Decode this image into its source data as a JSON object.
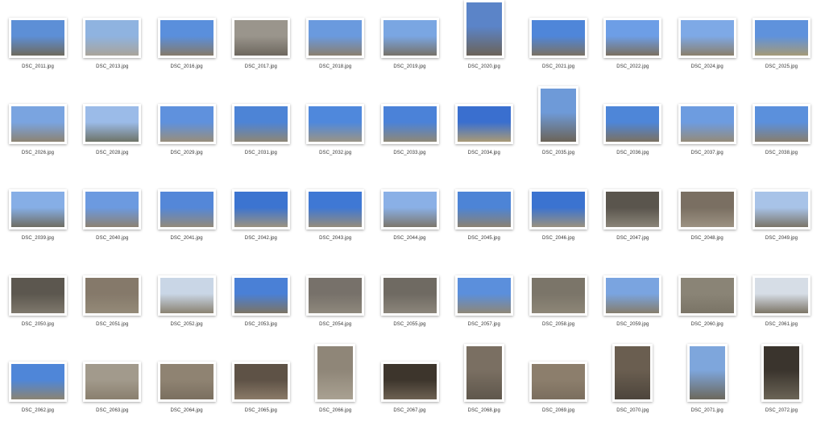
{
  "window": {
    "background": "#ffffff"
  },
  "files": [
    {
      "name": "DSC_2011.jpg",
      "orientation": "landscape",
      "sky": "#5d8fd6",
      "ground": "#6e6a5e"
    },
    {
      "name": "DSC_2013.jpg",
      "orientation": "landscape",
      "sky": "#8fb3e0",
      "ground": "#a9a49a"
    },
    {
      "name": "DSC_2016.jpg",
      "orientation": "landscape",
      "sky": "#5a8fdc",
      "ground": "#857a6a"
    },
    {
      "name": "DSC_2017.jpg",
      "orientation": "landscape",
      "sky": "#9a958c",
      "ground": "#6d675e"
    },
    {
      "name": "DSC_2018.jpg",
      "orientation": "landscape",
      "sky": "#6a9ade",
      "ground": "#8a7f6f"
    },
    {
      "name": "DSC_2019.jpg",
      "orientation": "landscape",
      "sky": "#7aa6e2",
      "ground": "#77726a"
    },
    {
      "name": "DSC_2020.jpg",
      "orientation": "portrait",
      "sky": "#5b84c8",
      "ground": "#6b6358"
    },
    {
      "name": "DSC_2021.jpg",
      "orientation": "landscape",
      "sky": "#4f86d9",
      "ground": "#7b7264"
    },
    {
      "name": "DSC_2022.jpg",
      "orientation": "landscape",
      "sky": "#6d9ee6",
      "ground": "#7a6f60"
    },
    {
      "name": "DSC_2024.jpg",
      "orientation": "landscape",
      "sky": "#7ea9e6",
      "ground": "#8a7f6c"
    },
    {
      "name": "DSC_2025.jpg",
      "orientation": "landscape",
      "sky": "#5f92dc",
      "ground": "#a59a78"
    },
    {
      "name": "DSC_2026.jpg",
      "orientation": "landscape",
      "sky": "#7aa4e0",
      "ground": "#8c8373"
    },
    {
      "name": "DSC_2028.jpg",
      "orientation": "landscape",
      "sky": "#9bbbe8",
      "ground": "#6e7368"
    },
    {
      "name": "DSC_2029.jpg",
      "orientation": "landscape",
      "sky": "#5f91dd",
      "ground": "#988e7c"
    },
    {
      "name": "DSC_2031.jpg",
      "orientation": "landscape",
      "sky": "#4d84d6",
      "ground": "#8d8676"
    },
    {
      "name": "DSC_2032.jpg",
      "orientation": "landscape",
      "sky": "#4f88dc",
      "ground": "#9a9486"
    },
    {
      "name": "DSC_2033.jpg",
      "orientation": "landscape",
      "sky": "#4b82d8",
      "ground": "#8e8878"
    },
    {
      "name": "DSC_2034.jpg",
      "orientation": "landscape",
      "sky": "#3a6fcf",
      "ground": "#a99a76"
    },
    {
      "name": "DSC_2035.jpg",
      "orientation": "portrait",
      "sky": "#6e9ad8",
      "ground": "#6b6458"
    },
    {
      "name": "DSC_2036.jpg",
      "orientation": "landscape",
      "sky": "#4e86d8",
      "ground": "#7b7162"
    },
    {
      "name": "DSC_2037.jpg",
      "orientation": "landscape",
      "sky": "#6d9ce0",
      "ground": "#948b7a"
    },
    {
      "name": "DSC_2038.jpg",
      "orientation": "landscape",
      "sky": "#5b90dc",
      "ground": "#877e6e"
    },
    {
      "name": "DSC_2039.jpg",
      "orientation": "landscape",
      "sky": "#86aee6",
      "ground": "#6f6d62"
    },
    {
      "name": "DSC_2040.jpg",
      "orientation": "landscape",
      "sky": "#6c9ae0",
      "ground": "#8c8272"
    },
    {
      "name": "DSC_2041.jpg",
      "orientation": "landscape",
      "sky": "#5487d8",
      "ground": "#938a7a"
    },
    {
      "name": "DSC_2042.jpg",
      "orientation": "landscape",
      "sky": "#3c74d0",
      "ground": "#9b9280"
    },
    {
      "name": "DSC_2043.jpg",
      "orientation": "landscape",
      "sky": "#3f78d4",
      "ground": "#958c7c"
    },
    {
      "name": "DSC_2044.jpg",
      "orientation": "landscape",
      "sky": "#8ab0e6",
      "ground": "#7c766c"
    },
    {
      "name": "DSC_2045.jpg",
      "orientation": "landscape",
      "sky": "#4d84d6",
      "ground": "#8b8272"
    },
    {
      "name": "DSC_2046.jpg",
      "orientation": "landscape",
      "sky": "#3b73d0",
      "ground": "#9a917f"
    },
    {
      "name": "DSC_2047.jpg",
      "orientation": "landscape",
      "sky": "#5a554d",
      "ground": "#8a8478"
    },
    {
      "name": "DSC_2048.jpg",
      "orientation": "landscape",
      "sky": "#7a6f62",
      "ground": "#9c9282"
    },
    {
      "name": "DSC_2049.jpg",
      "orientation": "landscape",
      "sky": "#a8c3e8",
      "ground": "#7a7468"
    },
    {
      "name": "DSC_2050.jpg",
      "orientation": "landscape",
      "sky": "#5c574f",
      "ground": "#7e786c"
    },
    {
      "name": "DSC_2051.jpg",
      "orientation": "landscape",
      "sky": "#85796a",
      "ground": "#948a78"
    },
    {
      "name": "DSC_2052.jpg",
      "orientation": "landscape",
      "sky": "#c9d6e6",
      "ground": "#8a8272"
    },
    {
      "name": "DSC_2053.jpg",
      "orientation": "landscape",
      "sky": "#4a80d6",
      "ground": "#7b7465"
    },
    {
      "name": "DSC_2054.jpg",
      "orientation": "landscape",
      "sky": "#77716a",
      "ground": "#8e887c"
    },
    {
      "name": "DSC_2055.jpg",
      "orientation": "landscape",
      "sky": "#6f6a62",
      "ground": "#8b857a"
    },
    {
      "name": "DSC_2057.jpg",
      "orientation": "landscape",
      "sky": "#5b8fdc",
      "ground": "#8e8778"
    },
    {
      "name": "DSC_2058.jpg",
      "orientation": "landscape",
      "sky": "#7b7569",
      "ground": "#8d8677"
    },
    {
      "name": "DSC_2059.jpg",
      "orientation": "landscape",
      "sky": "#7aa4e0",
      "ground": "#857d6c"
    },
    {
      "name": "DSC_2060.jpg",
      "orientation": "landscape",
      "sky": "#8a8476",
      "ground": "#7a7466"
    },
    {
      "name": "DSC_2061.jpg",
      "orientation": "landscape",
      "sky": "#d6dde6",
      "ground": "#7c7567"
    },
    {
      "name": "DSC_2062.jpg",
      "orientation": "landscape",
      "sky": "#4f86d8",
      "ground": "#8b8473"
    },
    {
      "name": "DSC_2063.jpg",
      "orientation": "landscape",
      "sky": "#a29a8c",
      "ground": "#8a7f6e"
    },
    {
      "name": "DSC_2064.jpg",
      "orientation": "landscape",
      "sky": "#8f8372",
      "ground": "#7a6f5f"
    },
    {
      "name": "DSC_2065.jpg",
      "orientation": "landscape",
      "sky": "#5e5246",
      "ground": "#8a7a68"
    },
    {
      "name": "DSC_2066.jpg",
      "orientation": "portrait",
      "sky": "#8f8678",
      "ground": "#a9a192"
    },
    {
      "name": "DSC_2067.jpg",
      "orientation": "landscape",
      "sky": "#3d352c",
      "ground": "#6d6152"
    },
    {
      "name": "DSC_2068.jpg",
      "orientation": "portrait",
      "sky": "#7a6f62",
      "ground": "#5f574c"
    },
    {
      "name": "DSC_2069.jpg",
      "orientation": "landscape",
      "sky": "#8c7e6c",
      "ground": "#7b6e5e"
    },
    {
      "name": "DSC_2070.jpg",
      "orientation": "portrait",
      "sky": "#6a5e50",
      "ground": "#4d453c"
    },
    {
      "name": "DSC_2071.jpg",
      "orientation": "portrait",
      "sky": "#7ea6dc",
      "ground": "#6c685c"
    },
    {
      "name": "DSC_2072.jpg",
      "orientation": "portrait",
      "sky": "#3a342d",
      "ground": "#6b6456"
    }
  ]
}
